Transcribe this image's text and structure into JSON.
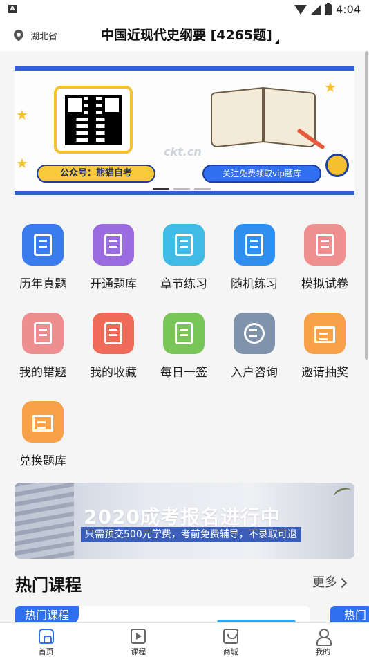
{
  "status_bar": {
    "left_icon": "A",
    "time": "4:04",
    "icons": [
      "wifi-icon",
      "signal-icon",
      "battery-icon"
    ]
  },
  "header": {
    "location": "湖北省",
    "title": "中国近现代史纲要 [4265题]"
  },
  "banner": {
    "left_pill": "公众号：熊猫自考",
    "right_pill": "关注免费领取vip题库",
    "watermark": "ckt.cn"
  },
  "grid": [
    {
      "label": "历年真题",
      "icon": "past-exam-icon",
      "color": "#3a7bf0"
    },
    {
      "label": "开通题库",
      "icon": "open-bank-icon",
      "color": "#9b6be0"
    },
    {
      "label": "章节练习",
      "icon": "chapter-practice-icon",
      "color": "#3fbbe6"
    },
    {
      "label": "随机练习",
      "icon": "random-practice-icon",
      "color": "#2f8ff0"
    },
    {
      "label": "模拟试卷",
      "icon": "mock-exam-icon",
      "color": "#ef8f8f"
    },
    {
      "label": "我的错题",
      "icon": "wrong-questions-icon",
      "color": "#ee8e91"
    },
    {
      "label": "我的收藏",
      "icon": "favorites-icon",
      "color": "#f06a5a"
    },
    {
      "label": "每日一签",
      "icon": "daily-sign-icon",
      "color": "#79c557"
    },
    {
      "label": "入户咨询",
      "icon": "consult-icon",
      "color": "#7f93ad"
    },
    {
      "label": "邀请抽奖",
      "icon": "invite-lottery-icon",
      "color": "#f8a148"
    },
    {
      "label": "兑换题库",
      "icon": "redeem-bank-icon",
      "color": "#f8a148"
    }
  ],
  "promo": {
    "title": "2020成考报名进行中",
    "subtitle": "只需预交500元学费，考前免费辅导，不录取可退"
  },
  "hot_courses": {
    "title": "热门课程",
    "more": "更多",
    "card_tag": "热门课程",
    "card_tag_2": "热门"
  },
  "tabbar": [
    {
      "label": "首页",
      "icon": "home-icon",
      "active": true
    },
    {
      "label": "课程",
      "icon": "course-icon",
      "active": false
    },
    {
      "label": "商城",
      "icon": "mall-icon",
      "active": false
    },
    {
      "label": "我的",
      "icon": "profile-icon",
      "active": false
    }
  ]
}
